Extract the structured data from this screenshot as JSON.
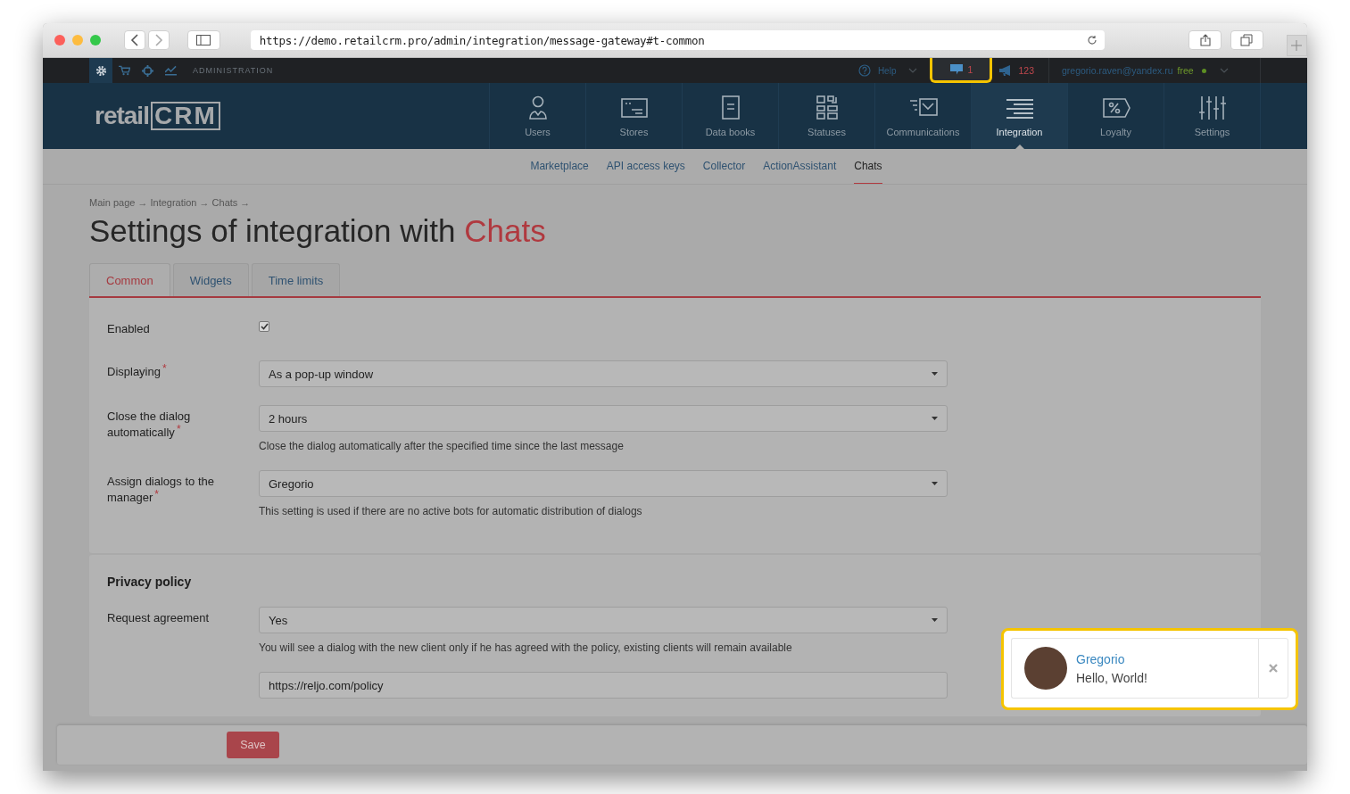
{
  "browser": {
    "url": "https://demo.retailcrm.pro/admin/integration/message-gateway#t-common"
  },
  "topbar": {
    "icons": [
      {
        "kind": "gear",
        "selected": true
      },
      {
        "kind": "cart",
        "selected": false
      },
      {
        "kind": "target",
        "selected": false
      },
      {
        "kind": "chart",
        "selected": false
      }
    ],
    "section": "ADMINISTRATION",
    "help": "Help",
    "chats_count": "1",
    "notifications_count": "123",
    "user_email": "gregorio.raven@yandex.ru",
    "plan": "free"
  },
  "logo": {
    "text": "retail",
    "mark": "CRM"
  },
  "nav": [
    {
      "label": "Users",
      "kind": "user",
      "selected": false
    },
    {
      "label": "Stores",
      "kind": "store",
      "selected": false
    },
    {
      "label": "Data books",
      "kind": "book",
      "selected": false
    },
    {
      "label": "Statuses",
      "kind": "grid",
      "selected": false
    },
    {
      "label": "Communications",
      "kind": "mail",
      "selected": false
    },
    {
      "label": "Integration",
      "kind": "lines",
      "selected": true
    },
    {
      "label": "Loyalty",
      "kind": "percent",
      "selected": false
    },
    {
      "label": "Settings",
      "kind": "sliders",
      "selected": false
    }
  ],
  "subnav": [
    {
      "label": "Marketplace",
      "selected": false
    },
    {
      "label": "API access keys",
      "selected": false
    },
    {
      "label": "Collector",
      "selected": false
    },
    {
      "label": "ActionAssistant",
      "selected": false
    },
    {
      "label": "Chats",
      "selected": true
    }
  ],
  "breadcrumbs": "Main page → Integration → Chats →",
  "title": "Settings of integration with",
  "title_highlight": "Chats",
  "tabs": [
    {
      "label": "Common",
      "selected": true
    },
    {
      "label": "Widgets",
      "selected": false
    },
    {
      "label": "Time limits",
      "selected": false
    }
  ],
  "required_mark": "*",
  "form": [
    {
      "kind": "checkbox",
      "label": "Enabled",
      "required": false,
      "checked": true
    },
    {
      "kind": "select",
      "label": "Displaying",
      "required": true,
      "value": "As a pop-up window"
    },
    {
      "kind": "select",
      "label": "Close the dialog automatically",
      "required": true,
      "value": "2 hours",
      "hint": "Close the dialog automatically after the specified time since the last message"
    },
    {
      "kind": "select",
      "label": "Assign dialogs to the manager",
      "required": true,
      "value": "Gregorio",
      "hint": "This setting is used if there are no active bots for automatic distribution of dialogs"
    }
  ],
  "privacy": {
    "heading": "Privacy policy",
    "fields": [
      {
        "kind": "select",
        "label": "Request agreement",
        "required": false,
        "value": "Yes",
        "hint": "You will see a dialog with the new client only if he has agreed with the policy, existing clients will remain available"
      },
      {
        "kind": "text",
        "value": "https://reljo.com/policy"
      }
    ]
  },
  "save_button": "Save",
  "notification": {
    "name": "Gregorio",
    "message": "Hello, World!"
  }
}
